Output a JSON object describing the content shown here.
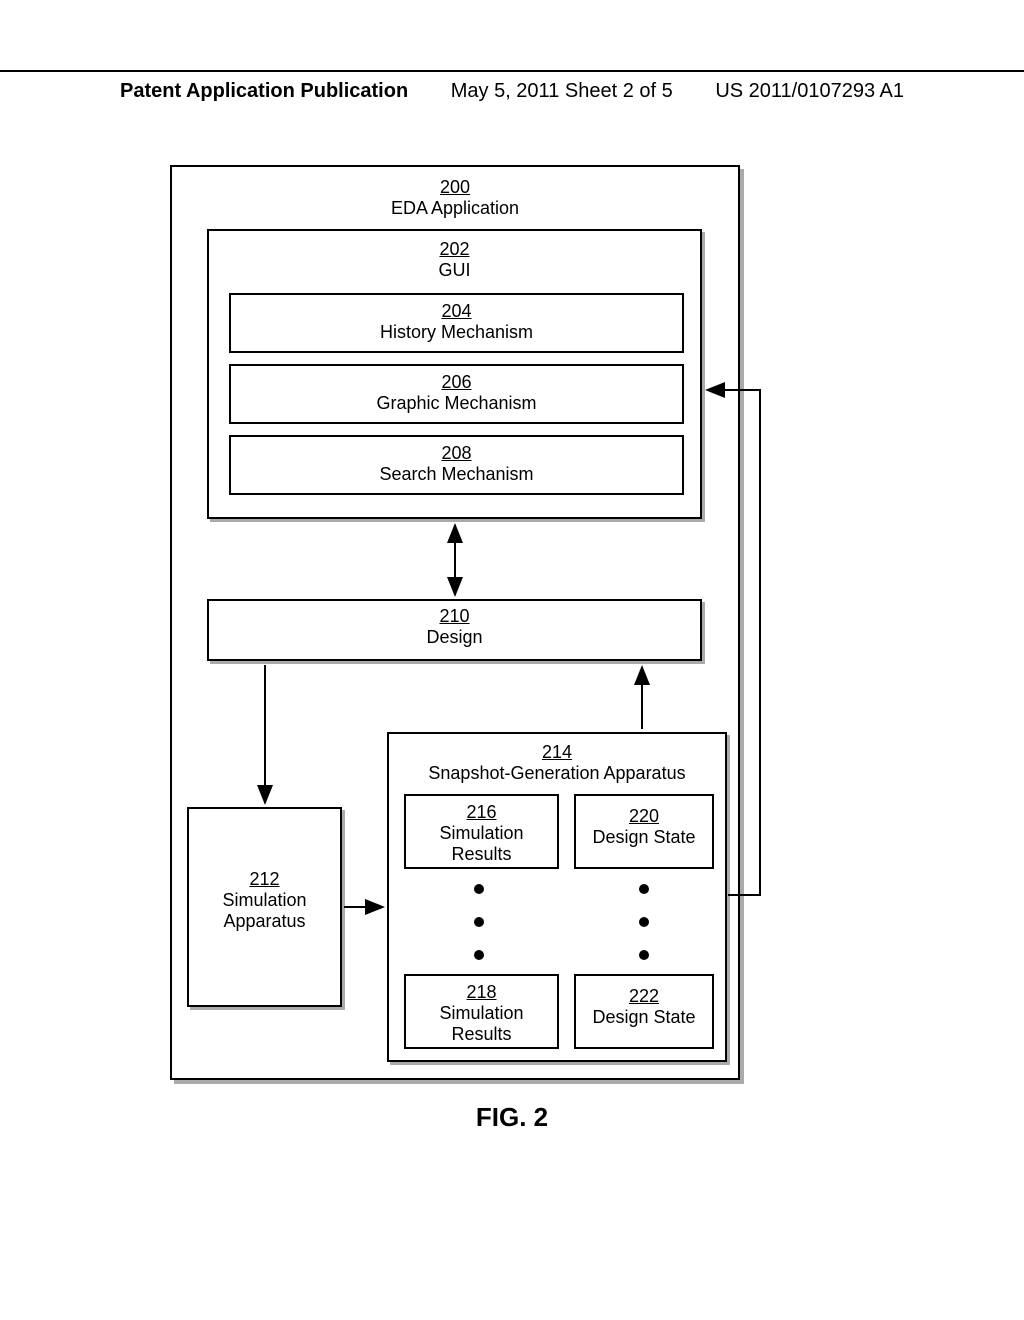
{
  "header": {
    "left": "Patent Application Publication",
    "center": "May 5, 2011  Sheet 2 of 5",
    "right": "US 2011/0107293 A1"
  },
  "diagram": {
    "eda": {
      "num": "200",
      "label": "EDA Application"
    },
    "gui": {
      "num": "202",
      "label": "GUI"
    },
    "history": {
      "num": "204",
      "label": "History Mechanism"
    },
    "graphic": {
      "num": "206",
      "label": "Graphic Mechanism"
    },
    "search": {
      "num": "208",
      "label": "Search Mechanism"
    },
    "design": {
      "num": "210",
      "label": "Design"
    },
    "simulation": {
      "num": "212",
      "label": "Simulation Apparatus"
    },
    "snapshot": {
      "num": "214",
      "label": "Snapshot-Generation Apparatus"
    },
    "simresults1": {
      "num": "216",
      "label": "Simulation Results"
    },
    "simresults2": {
      "num": "218",
      "label": "Simulation Results"
    },
    "designstate1": {
      "num": "220",
      "label": "Design State"
    },
    "designstate2": {
      "num": "222",
      "label": "Design State"
    }
  },
  "figure": "FIG. 2"
}
